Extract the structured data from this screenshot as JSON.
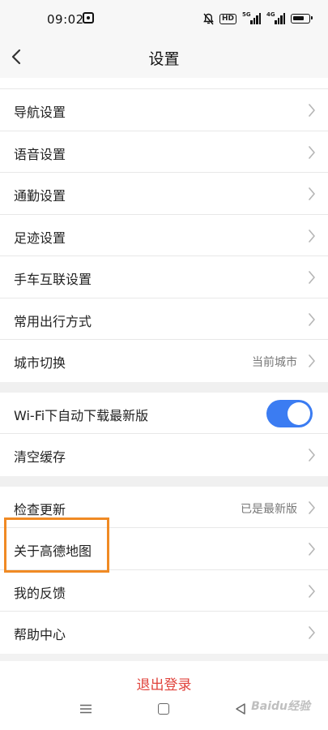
{
  "status_bar": {
    "time": "09:02",
    "hd_label": "HD",
    "signal1_label": "5G",
    "signal2_label": "4G"
  },
  "header": {
    "title": "设置"
  },
  "groups": [
    {
      "items": [
        {
          "label": "导航设置"
        },
        {
          "label": "语音设置"
        },
        {
          "label": "通勤设置"
        },
        {
          "label": "足迹设置"
        },
        {
          "label": "手车互联设置"
        },
        {
          "label": "常用出行方式"
        },
        {
          "label": "城市切换",
          "value": "当前城市"
        }
      ]
    },
    {
      "items": [
        {
          "label": "Wi-Fi下自动下载最新版",
          "toggle": true
        },
        {
          "label": "清空缓存"
        }
      ]
    },
    {
      "items": [
        {
          "label": "检查更新",
          "value": "已是最新版"
        },
        {
          "label": "关于高德地图"
        },
        {
          "label": "我的反馈"
        },
        {
          "label": "帮助中心"
        }
      ]
    }
  ],
  "logout": {
    "label": "退出登录"
  },
  "watermark": "Baidu经验",
  "colors": {
    "accent": "#3b7cf2",
    "logout": "#e0433c",
    "highlight": "#f08a24"
  }
}
